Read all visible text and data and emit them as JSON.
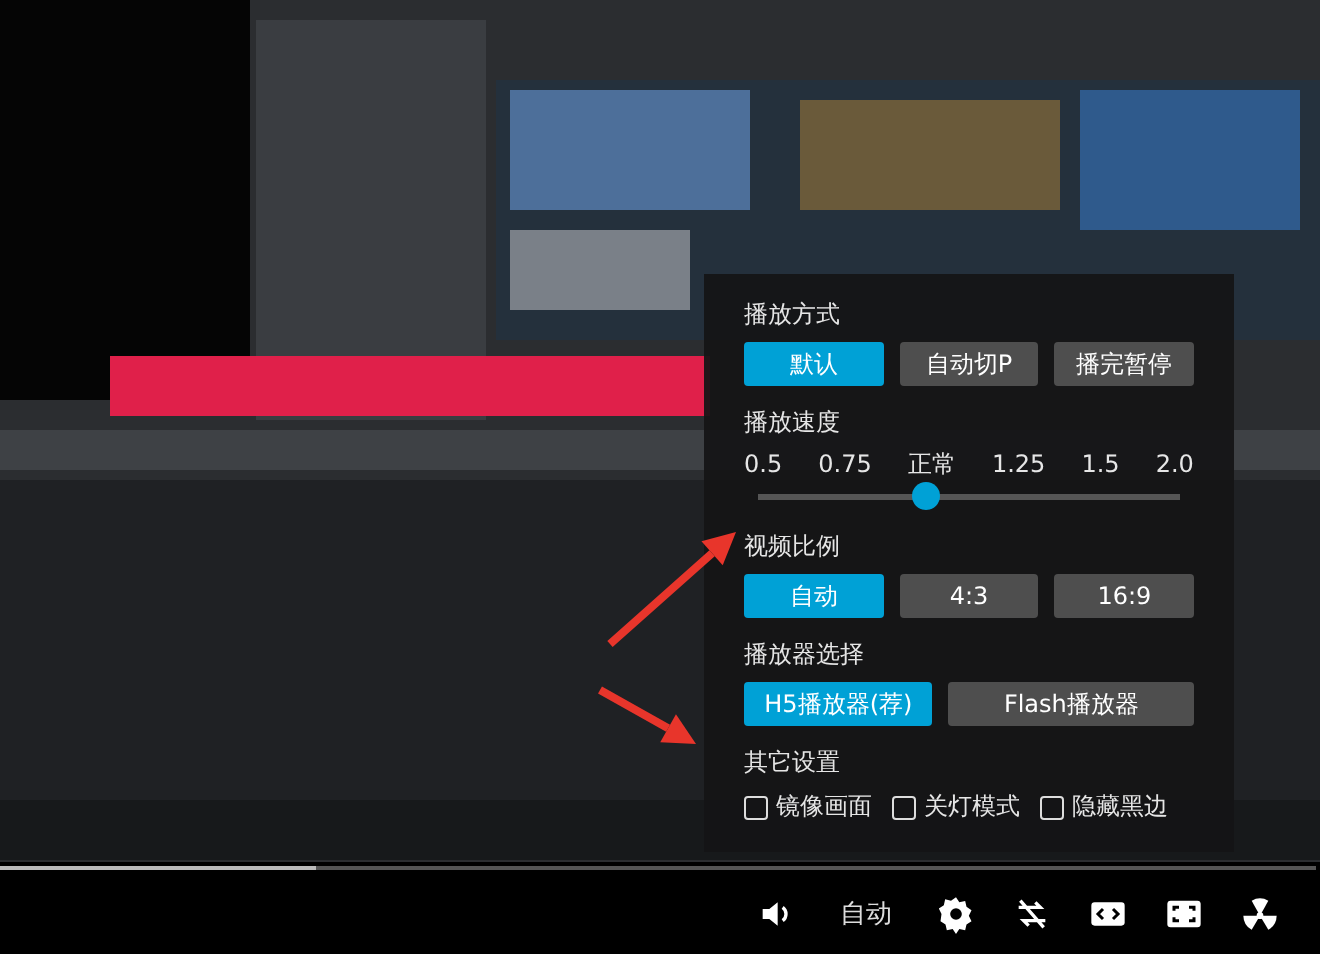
{
  "settings": {
    "play_mode": {
      "title": "播放方式",
      "options": [
        {
          "label": "默认",
          "selected": true
        },
        {
          "label": "自动切P",
          "selected": false
        },
        {
          "label": "播完暂停",
          "selected": false
        }
      ]
    },
    "speed": {
      "title": "播放速度",
      "labels": [
        "0.5",
        "0.75",
        "正常",
        "1.25",
        "1.5",
        "2.0"
      ],
      "level": 0.4
    },
    "aspect": {
      "title": "视频比例",
      "options": [
        {
          "label": "自动",
          "selected": true
        },
        {
          "label": "4:3",
          "selected": false
        },
        {
          "label": "16:9",
          "selected": false
        }
      ]
    },
    "player": {
      "title": "播放器选择",
      "options": [
        {
          "label": "H5播放器(荐)",
          "selected": true
        },
        {
          "label": "Flash播放器",
          "selected": false
        }
      ]
    },
    "other": {
      "title": "其它设置",
      "checkboxes": [
        {
          "label": "镜像画面",
          "checked": false
        },
        {
          "label": "关灯模式",
          "checked": false
        },
        {
          "label": "隐藏黑边",
          "checked": false
        }
      ]
    }
  },
  "progress": {
    "level": 0.24
  },
  "controls": {
    "quality": "自动"
  }
}
